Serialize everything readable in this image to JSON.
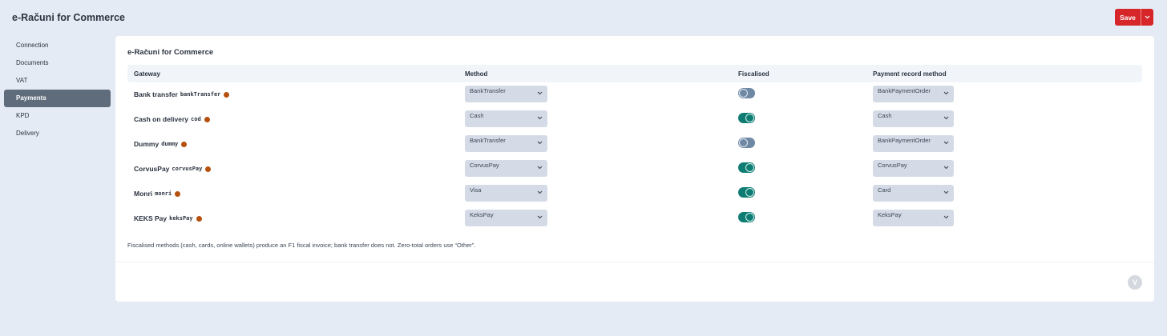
{
  "app": {
    "title": "e-Računi for Commerce"
  },
  "toolbar": {
    "save_label": "Save"
  },
  "sidebar": {
    "items": [
      {
        "label": "Connection",
        "active": false
      },
      {
        "label": "Documents",
        "active": false
      },
      {
        "label": "VAT",
        "active": false
      },
      {
        "label": "Payments",
        "active": true
      },
      {
        "label": "KPD",
        "active": false
      },
      {
        "label": "Delivery",
        "active": false
      }
    ]
  },
  "panel": {
    "title": "e-Računi for Commerce",
    "columns": {
      "gateway": "Gateway",
      "method": "Method",
      "fiscalised": "Fiscalised",
      "payment_record": "Payment record method"
    },
    "rows": [
      {
        "name": "Bank transfer",
        "code": "bankTransfer",
        "method": "BankTransfer",
        "fiscalised": false,
        "payment_record": "BankPaymentOrder"
      },
      {
        "name": "Cash on delivery",
        "code": "cod",
        "method": "Cash",
        "fiscalised": true,
        "payment_record": "Cash"
      },
      {
        "name": "Dummy",
        "code": "dummy",
        "method": "BankTransfer",
        "fiscalised": false,
        "payment_record": "BankPaymentOrder"
      },
      {
        "name": "CorvusPay",
        "code": "corvusPay",
        "method": "CorvusPay",
        "fiscalised": true,
        "payment_record": "CorvusPay"
      },
      {
        "name": "Monri",
        "code": "monri",
        "method": "Visa",
        "fiscalised": true,
        "payment_record": "Card"
      },
      {
        "name": "KEKS Pay",
        "code": "keksPay",
        "method": "KeksPay",
        "fiscalised": true,
        "payment_record": "KeksPay"
      }
    ],
    "note": "Fiscalised methods (cash, cards, online wallets) produce an F1 fiscal invoice; bank transfer does not. Zero-total orders use “Other”.",
    "badge": "V"
  },
  "colors": {
    "accent": "#d6262a",
    "toggle_on": "#0e7c73",
    "toggle_off": "#6f88a3",
    "gateway_dot": "#b5500f",
    "sidebar_active": "#5f6c7b"
  },
  "icons": {
    "dropdown": "chevron-down-icon",
    "status": "status-dot-icon",
    "brand": "v-logo-icon"
  }
}
